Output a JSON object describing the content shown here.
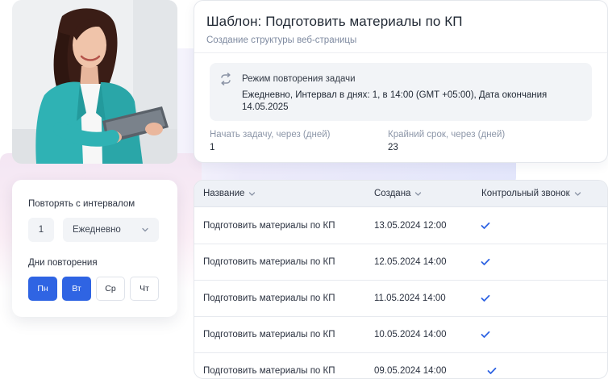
{
  "template": {
    "title": "Шаблон: Подготовить материалы по КП",
    "subtitle": "Создание структуры веб-страницы",
    "repeat": {
      "icon": "repeat-icon",
      "title": "Режим повторения задачи",
      "description": "Ежедневно, Интервал в днях: 1, в 14:00 (GMT +05:00), Дата окончания 14.05.2025"
    },
    "start": {
      "label": "Начать задачу, через (дней)",
      "value": "1"
    },
    "deadline": {
      "label": "Крайний срок, через (дней)",
      "value": "23"
    }
  },
  "interval": {
    "label": "Повторять с интервалом",
    "count": "1",
    "period": "Ежедневно",
    "days_label": "Дни повторения",
    "days": [
      {
        "label": "Пн",
        "active": true
      },
      {
        "label": "Вт",
        "active": true
      },
      {
        "label": "Ср",
        "active": false
      },
      {
        "label": "Чт",
        "active": false
      }
    ]
  },
  "table": {
    "columns": [
      "Название",
      "Создана",
      "Контрольный звонок"
    ],
    "rows": [
      {
        "name": "Подготовить материалы по КП",
        "created": "13.05.2024 12:00",
        "call": true
      },
      {
        "name": "Подготовить материалы по КП",
        "created": "12.05.2024 14:00",
        "call": true
      },
      {
        "name": "Подготовить материалы по КП",
        "created": "11.05.2024 14:00",
        "call": true
      },
      {
        "name": "Подготовить материалы по КП",
        "created": "10.05.2024 14:00",
        "call": true
      },
      {
        "name": "Подготовить материалы по КП",
        "created": "09.05.2024 14:00",
        "call": true
      }
    ]
  },
  "colors": {
    "accent": "#2f64e3",
    "check": "#2f64e3",
    "jacket": "#2fb2b4"
  }
}
